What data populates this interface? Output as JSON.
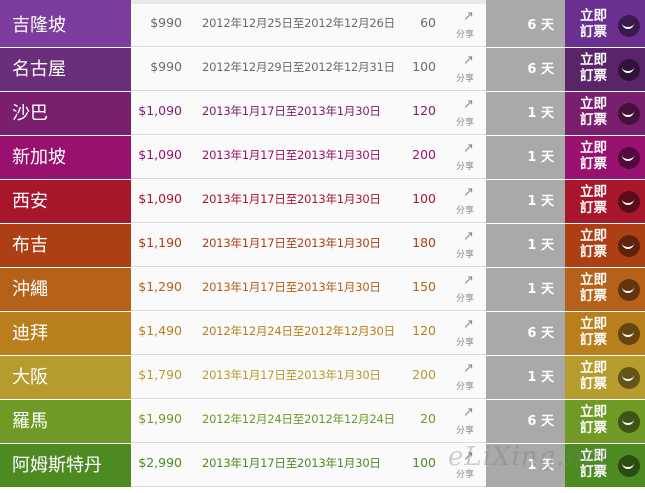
{
  "colors": {
    "share_text": "#8a8a8a",
    "days_bg": "#a9a9a9"
  },
  "share_label": "分享",
  "book_label": "立即\n訂票",
  "watermark": "eLiXing.net",
  "rows": [
    {
      "city": "吉隆坡",
      "price": "$990",
      "dates": "2012年12月25日至2012年12月26日",
      "seats": "60",
      "days": "6 天",
      "color": "#7c3d9e",
      "book_color": "#6a2f8f",
      "text_color": "#6b6b6b"
    },
    {
      "city": "名古屋",
      "price": "$990",
      "dates": "2012年12月29日至2012年12月31日",
      "seats": "100",
      "days": "6 天",
      "color": "#6b2e7a",
      "book_color": "#5a2468",
      "text_color": "#6b6b6b"
    },
    {
      "city": "沙巴",
      "price": "$1,090",
      "dates": "2013年1月17日至2013年1月30日",
      "seats": "120",
      "days": "1 天",
      "color": "#7a1f6e",
      "book_color": "#7a1f6e",
      "text_color": "#7a1f6e"
    },
    {
      "city": "新加坡",
      "price": "$1,090",
      "dates": "2013年1月17日至2013年1月30日",
      "seats": "200",
      "days": "1 天",
      "color": "#98116f",
      "book_color": "#98116f",
      "text_color": "#98116f"
    },
    {
      "city": "西安",
      "price": "$1,090",
      "dates": "2013年1月17日至2013年1月30日",
      "seats": "100",
      "days": "1 天",
      "color": "#a8162c",
      "book_color": "#a8162c",
      "text_color": "#a8162c"
    },
    {
      "city": "布吉",
      "price": "$1,190",
      "dates": "2013年1月17日至2013年1月30日",
      "seats": "180",
      "days": "1 天",
      "color": "#ad3f14",
      "book_color": "#ad3f14",
      "text_color": "#ad3f14"
    },
    {
      "city": "沖繩",
      "price": "$1,290",
      "dates": "2013年1月17日至2013年1月30日",
      "seats": "150",
      "days": "1 天",
      "color": "#b5611a",
      "book_color": "#b5611a",
      "text_color": "#b5611a"
    },
    {
      "city": "迪拜",
      "price": "$1,490",
      "dates": "2012年12月24日至2012年12月30日",
      "seats": "120",
      "days": "6 天",
      "color": "#b87f1c",
      "book_color": "#b87f1c",
      "text_color": "#b87f1c"
    },
    {
      "city": "大阪",
      "price": "$1,790",
      "dates": "2013年1月17日至2013年1月30日",
      "seats": "200",
      "days": "1 天",
      "color": "#b59c2d",
      "book_color": "#b59c2d",
      "text_color": "#b59c2d"
    },
    {
      "city": "羅馬",
      "price": "$1,990",
      "dates": "2012年12月24日至2012年12月24日",
      "seats": "20",
      "days": "6 天",
      "color": "#6f9a25",
      "book_color": "#6f9a25",
      "text_color": "#6f9a25"
    },
    {
      "city": "阿姆斯特丹",
      "price": "$2,990",
      "dates": "2013年1月17日至2013年1月30日",
      "seats": "100",
      "days": "1 天",
      "color": "#4e8a22",
      "book_color": "#4e8a22",
      "text_color": "#4e8a22"
    }
  ]
}
